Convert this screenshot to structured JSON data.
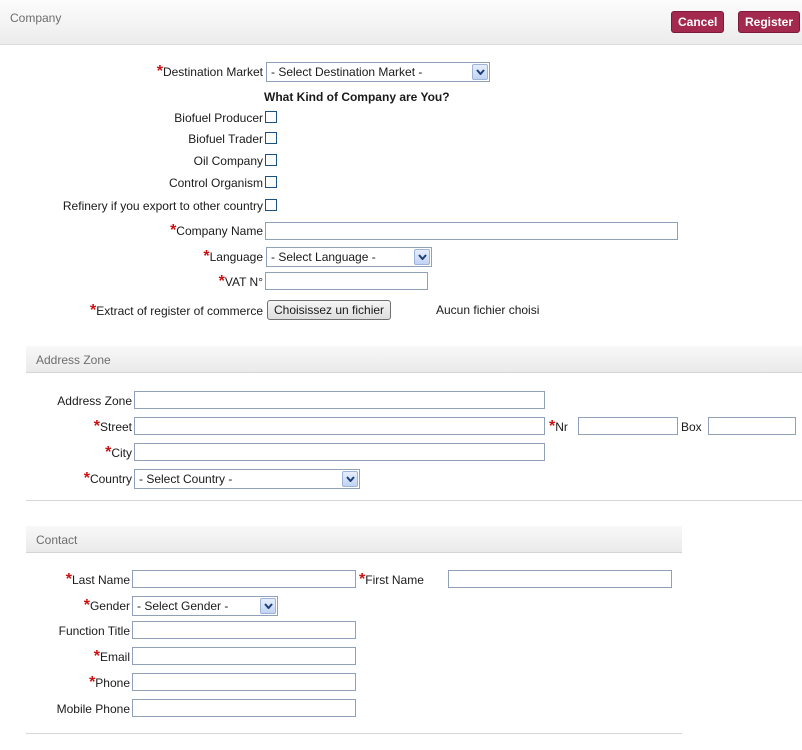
{
  "header": {
    "title": "Company",
    "cancel_label": "Cancel",
    "register_label": "Register"
  },
  "company": {
    "destination_market_label": "Destination Market",
    "destination_market_value": "- Select Destination Market -",
    "question": "What Kind of Company are You?",
    "types": [
      {
        "label": "Biofuel Producer",
        "checked": false
      },
      {
        "label": "Biofuel Trader",
        "checked": false
      },
      {
        "label": "Oil Company",
        "checked": false
      },
      {
        "label": "Control Organism",
        "checked": false
      },
      {
        "label": "Refinery if you export to other country",
        "checked": false
      }
    ],
    "company_name_label": "Company Name",
    "company_name_value": "",
    "language_label": "Language",
    "language_value": "- Select Language -",
    "vat_label": "VAT N°",
    "vat_value": "",
    "extract_label": "Extract of register of commerce",
    "file_button_label": "Choisissez un fichier",
    "file_status": "Aucun fichier choisi"
  },
  "address": {
    "section_title": "Address Zone",
    "zone_label": "Address Zone",
    "street_label": "Street",
    "nr_label": "Nr",
    "box_label": "Box",
    "city_label": "City",
    "country_label": "Country",
    "country_value": "- Select Country -"
  },
  "contact": {
    "section_title": "Contact",
    "last_name_label": "Last Name",
    "first_name_label": "First Name",
    "gender_label": "Gender",
    "gender_value": "- Select Gender -",
    "function_title_label": "Function Title",
    "email_label": "Email",
    "phone_label": "Phone",
    "mobile_phone_label": "Mobile Phone"
  },
  "colors": {
    "button": "#a3294f",
    "required_star": "#cc1111",
    "input_border": "#8fa0b8"
  },
  "icons": {
    "dropdown": "chevron-down-icon"
  }
}
